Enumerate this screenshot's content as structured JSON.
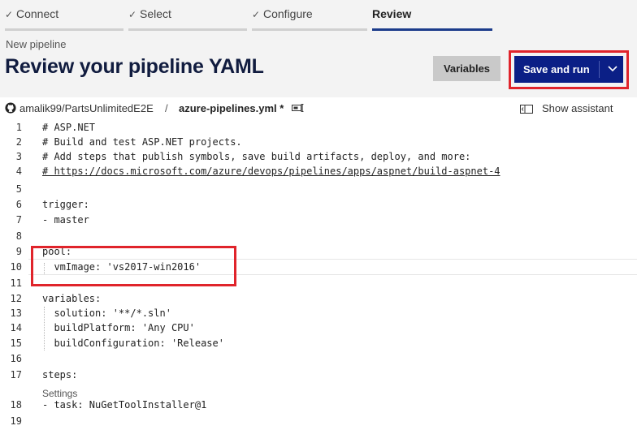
{
  "wizard": {
    "steps": [
      {
        "label": "Connect",
        "done": true
      },
      {
        "label": "Select",
        "done": true
      },
      {
        "label": "Configure",
        "done": true
      },
      {
        "label": "Review",
        "done": false,
        "active": true
      }
    ]
  },
  "header": {
    "breadcrumb": "New pipeline",
    "title": "Review your pipeline YAML",
    "variables_label": "Variables",
    "save_run_label": "Save and run"
  },
  "path_bar": {
    "repo": "amalik99/PartsUnlimitedE2E",
    "separator": "/",
    "file": "azure-pipelines.yml *",
    "show_assistant_label": "Show assistant"
  },
  "editor": {
    "lines": [
      {
        "n": "1",
        "text": "# ASP.NET"
      },
      {
        "n": "2",
        "text": "# Build and test ASP.NET projects."
      },
      {
        "n": "3",
        "text": "# Add steps that publish symbols, save build artifacts, deploy, and more:"
      },
      {
        "n": "4",
        "text": "# https://docs.microsoft.com/azure/devops/pipelines/apps/aspnet/build-aspnet-4"
      },
      {
        "n": "5",
        "text": ""
      },
      {
        "n": "6",
        "text": "trigger:"
      },
      {
        "n": "7",
        "text": "- master"
      },
      {
        "n": "8",
        "text": ""
      },
      {
        "n": "9",
        "text": "pool:"
      },
      {
        "n": "10",
        "text": "  vmImage: 'vs2017-win2016'"
      },
      {
        "n": "11",
        "text": ""
      },
      {
        "n": "12",
        "text": "variables:"
      },
      {
        "n": "13",
        "text": "  solution: '**/*.sln'"
      },
      {
        "n": "14",
        "text": "  buildPlatform: 'Any CPU'"
      },
      {
        "n": "15",
        "text": "  buildConfiguration: 'Release'"
      },
      {
        "n": "16",
        "text": ""
      },
      {
        "n": "17",
        "text": "steps:"
      },
      {
        "n": "18",
        "text": "- task: NuGetToolInstaller@1"
      },
      {
        "n": "19",
        "text": ""
      }
    ],
    "codelens": "Settings"
  },
  "colors": {
    "accent": "#0b1f86",
    "highlight_box": "#e0242b",
    "title": "#111c3f"
  },
  "icons": {
    "step_done": "checkmark-icon",
    "repo": "github-icon",
    "rename": "rename-icon",
    "assistant": "show-assistant-icon",
    "dropdown": "chevron-down-icon"
  }
}
